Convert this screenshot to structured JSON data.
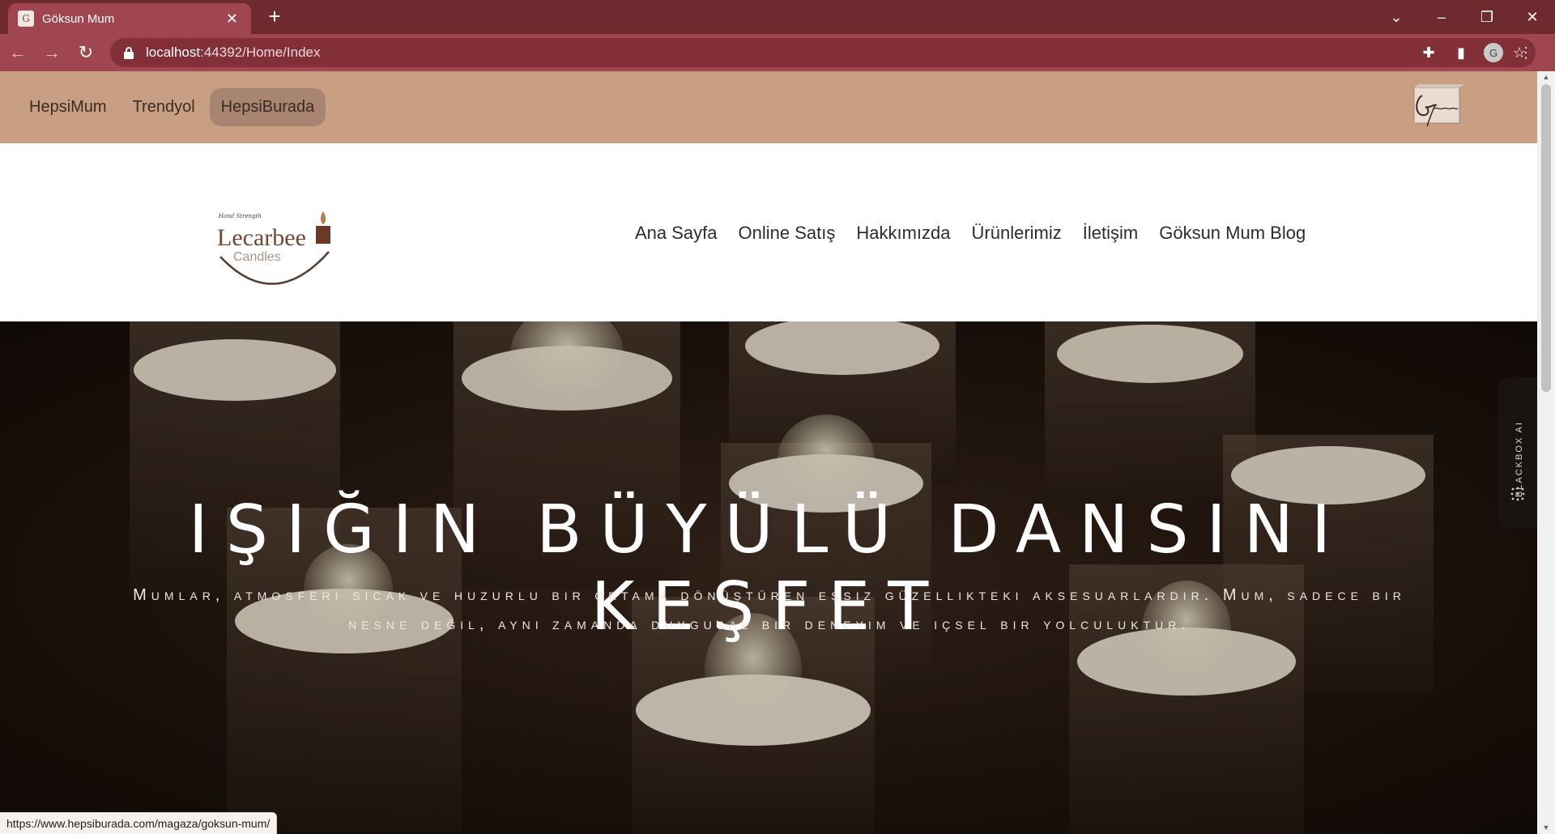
{
  "browser": {
    "tab_title": "Göksun Mum",
    "url_host": "localhost",
    "url_path": ":44392/Home/Index",
    "profile_initial": "G"
  },
  "topbar": {
    "links": [
      {
        "label": "HepsiMum"
      },
      {
        "label": "Trendyol"
      },
      {
        "label": "HepsiBurada"
      }
    ],
    "active_index": 2
  },
  "header": {
    "brand_script": "Hand Strength",
    "brand_name": "Lecarbee",
    "brand_sub": "Candles",
    "nav": [
      {
        "label": "Ana Sayfa"
      },
      {
        "label": "Online Satış"
      },
      {
        "label": "Hakkımızda"
      },
      {
        "label": "Ürünlerimiz"
      },
      {
        "label": "İletişim"
      },
      {
        "label": "Göksun Mum Blog"
      }
    ]
  },
  "hero": {
    "title": "IŞIĞIN BÜYÜLÜ DANSINI KEŞFET",
    "subtitle": "Mumlar, atmosferi sıcak ve huzurlu bir ortama dönüştüren eşsiz güzellikteki aksesuarlardır. Mum, sadece bir nesne değil, aynı zamanda duygusal bir deneyim ve içsel bir yolculuktur."
  },
  "side_widget": {
    "label": "BLACKBOX AI"
  },
  "status_url": "https://www.hepsiburada.com/magaza/goksun-mum/",
  "colors": {
    "tabbar": "#6e2a2e",
    "toolbar": "#a04650",
    "topbar": "#c99f84",
    "active_link": "#a88570"
  }
}
